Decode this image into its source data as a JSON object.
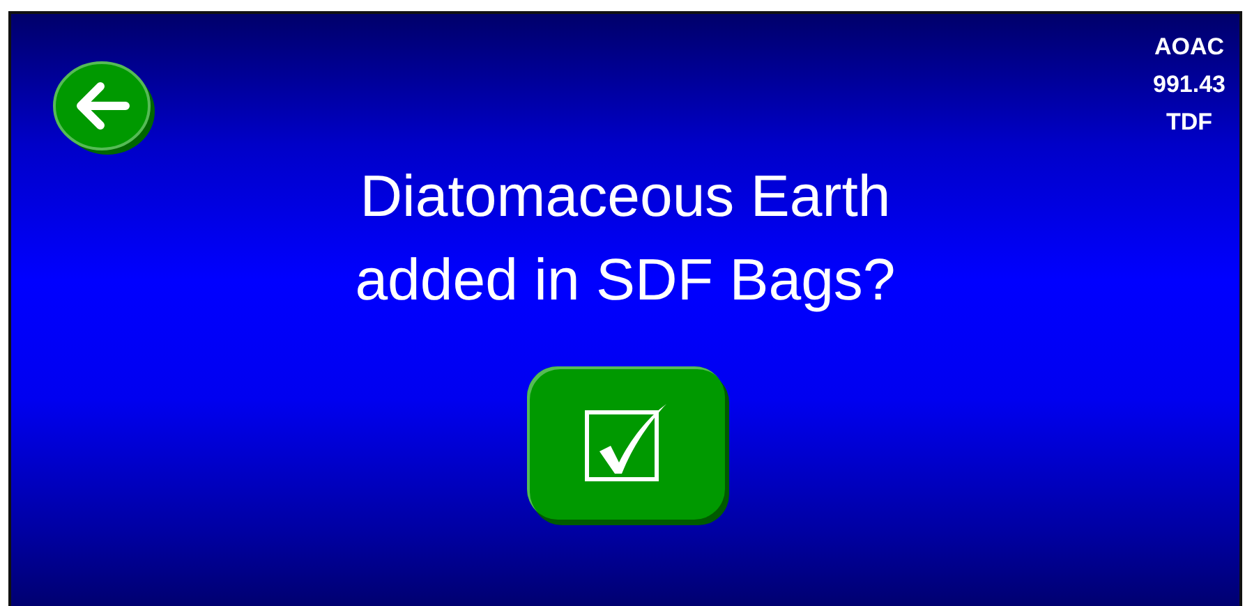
{
  "back_button": {
    "kind": "arrow"
  },
  "method_label": "AOAC\n991.43\nTDF",
  "question": "Diatomaceous Earth\nadded in SDF Bags?",
  "confirm_button": {
    "kind": "check"
  }
}
